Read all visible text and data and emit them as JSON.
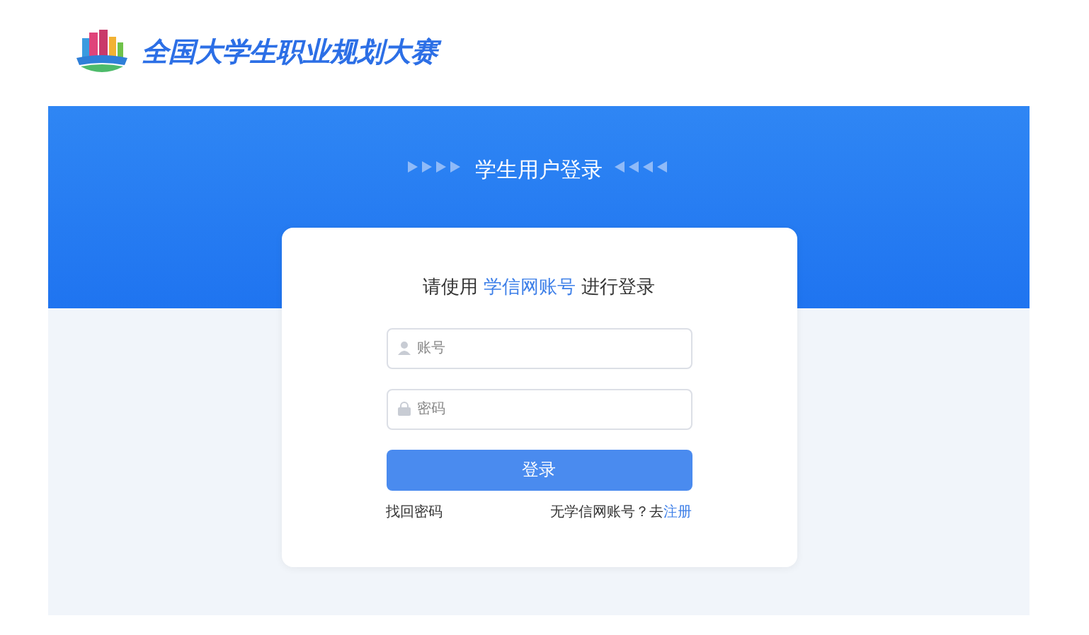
{
  "header": {
    "site_title": "全国大学生职业规划大赛"
  },
  "banner": {
    "title": "学生用户登录"
  },
  "login": {
    "intro_before": "请使用",
    "intro_link": "学信网账号",
    "intro_after": "进行登录",
    "fields": [
      {
        "kind": "user",
        "placeholder": "账号"
      },
      {
        "kind": "lock",
        "placeholder": "密码"
      }
    ],
    "submit": "登录",
    "forgot": "找回密码",
    "register_prompt": "无学信网账号？去",
    "register_link": "注册"
  }
}
